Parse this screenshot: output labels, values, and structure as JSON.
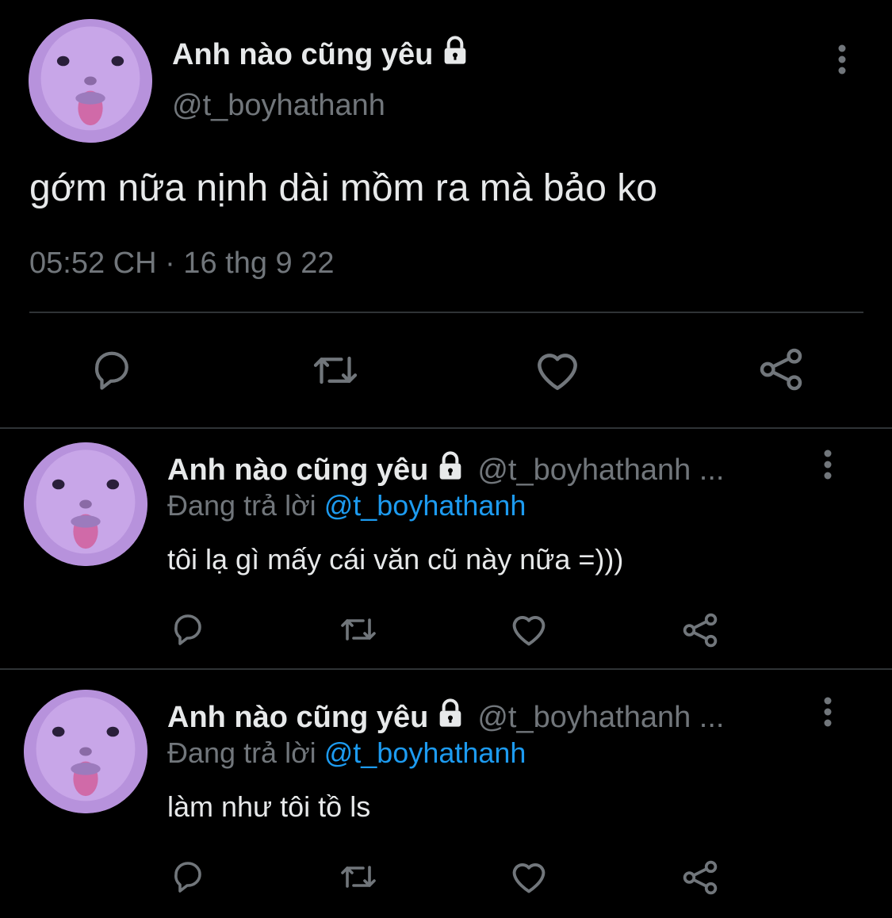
{
  "main_tweet": {
    "display_name": "Anh nào cũng yêu",
    "handle": "@t_boyhathanh",
    "text": "gớm nữa nịnh dài mồm ra mà bảo ko",
    "timestamp": "05:52 CH · 16 thg 9 22",
    "actions": [
      "reply-icon",
      "retweet-icon",
      "like-icon",
      "share-icon"
    ]
  },
  "replies": [
    {
      "display_name": "Anh nào cũng yêu",
      "handle": "@t_boyhathanh ...",
      "replying_prefix": "Đang trả lời",
      "replying_to": "@t_boyhathanh",
      "text": "tôi lạ gì mấy cái văn cũ này nữa =)))"
    },
    {
      "display_name": "Anh nào cũng yêu",
      "handle": "@t_boyhathanh ...",
      "replying_prefix": "Đang trả lời",
      "replying_to": "@t_boyhathanh",
      "text": "làm như tôi tồ ls"
    }
  ],
  "colors": {
    "background": "#000000",
    "primary_text": "#e7e9ea",
    "secondary_text": "#71767b",
    "link": "#1d9bf0",
    "divider": "#2f3336",
    "avatar_tint": "#b792dc"
  }
}
